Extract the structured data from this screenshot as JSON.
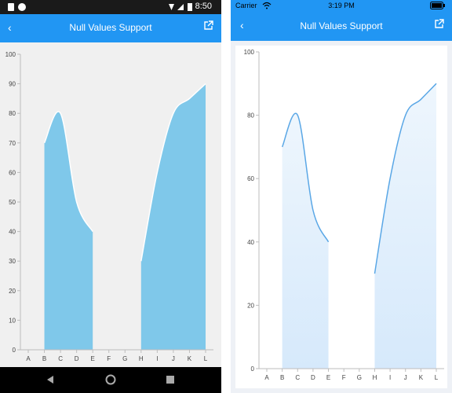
{
  "android": {
    "status_time": "8:50",
    "title": "Null Values Support",
    "icons": {
      "back": "back-arrow-icon",
      "external": "open-external-icon",
      "nav_back": "nav-back-icon",
      "nav_home": "nav-home-icon",
      "nav_recent": "nav-recent-icon"
    }
  },
  "ios": {
    "carrier": "Carrier",
    "status_time": "3:19 PM",
    "title": "Null Values Support",
    "icons": {
      "back": "back-arrow-icon",
      "external": "open-external-icon",
      "wifi": "wifi-icon",
      "battery": "battery-icon"
    }
  },
  "colors": {
    "app_bar": "#2196f3",
    "android_fill": "#7fc8ea",
    "ios_line": "#5aa7e6",
    "ios_fill_top": "#eef6fd",
    "ios_fill_bottom": "#d6e9fb"
  },
  "chart_data": [
    {
      "type": "area",
      "platform": "android",
      "categories": [
        "A",
        "B",
        "C",
        "D",
        "E",
        "F",
        "G",
        "H",
        "I",
        "J",
        "K",
        "L"
      ],
      "values": [
        null,
        70,
        80,
        50,
        40,
        null,
        null,
        30,
        60,
        80,
        85,
        90
      ],
      "ylim": [
        0,
        100
      ],
      "yticks": [
        0,
        10,
        20,
        30,
        40,
        50,
        60,
        70,
        80,
        90,
        100
      ],
      "smooth": true,
      "grid": false
    },
    {
      "type": "area",
      "platform": "ios",
      "categories": [
        "A",
        "B",
        "C",
        "D",
        "E",
        "F",
        "G",
        "H",
        "I",
        "J",
        "K",
        "L"
      ],
      "values": [
        null,
        70,
        80,
        50,
        40,
        null,
        null,
        30,
        60,
        80,
        85,
        90
      ],
      "ylim": [
        0,
        100
      ],
      "yticks": [
        0,
        20,
        40,
        60,
        80,
        100
      ],
      "smooth": true,
      "grid": false
    }
  ]
}
